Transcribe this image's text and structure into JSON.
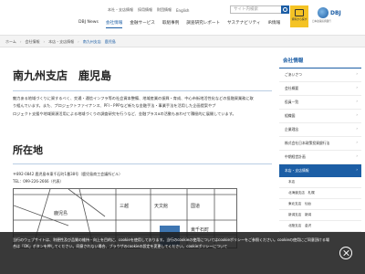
{
  "utility": {
    "items": [
      "本社・支店情報",
      "採用情報",
      "財団情報",
      "English"
    ],
    "search_placeholder": "サイト内検索"
  },
  "nav": {
    "items": [
      "DBJ News",
      "会社情報",
      "金融サービス",
      "取組事例",
      "調査研究レポート",
      "サステナビリティ",
      "IR情報"
    ]
  },
  "cta": {
    "label": "資料から探す"
  },
  "logo": {
    "name": "DBJ",
    "sub": "日本政策投資銀行"
  },
  "breadcrumb": {
    "items": [
      "ホーム",
      "会社情報",
      "本店・支店情報",
      "南九州支店　鹿児島"
    ]
  },
  "page": {
    "title": "南九州支店　鹿児島",
    "intro_lines": [
      "魅力ある地域づくりに資するべく、交通・通信インフラ等の社会資本整備、地域産業の振興・育成、中心市街地活性化などの投融資業務に取",
      "り組んでいます。また、プロジェクトファイナンス、PFI・PPPなど新たな金融手法・事業手法を活用した企画提案やプ",
      "ロジェクト支援や地域資源活用による地域づくりの調査研究を行うなど、金融プラスαの活動もあわせて積極的に展開しています。"
    ],
    "location_heading": "所在地",
    "address": "〒892-0842 鹿児島市東千石町1番38号（鹿児島商工会議所ビル）",
    "tel": "TEL：099-226-2666（代表）"
  },
  "map": {
    "labels": [
      "鹿児島",
      "三越",
      "天文館",
      "国道",
      "東千石町"
    ]
  },
  "sidebar": {
    "heading": "会社情報",
    "items": [
      {
        "label": "ごあいさつ"
      },
      {
        "label": "会社概要"
      },
      {
        "label": "役員一覧"
      },
      {
        "label": "組織図"
      },
      {
        "label": "企業理念"
      },
      {
        "label": "株式会社日本政策投資銀行法"
      },
      {
        "label": "中期経営計画"
      }
    ],
    "section": "本店・支店情報",
    "subitems": [
      {
        "label": "本店",
        "current": false
      },
      {
        "label": "北海道支店　札幌",
        "current": false
      },
      {
        "label": "東北支店　仙台",
        "current": false
      },
      {
        "label": "新潟支店　新潟",
        "current": false
      },
      {
        "label": "北陸支店　金沢",
        "current": false
      }
    ]
  },
  "cookie": {
    "text": "当行のウェブサイトは、利便性及び品質の維持・向上を目的に、cookieを使用しております。当行のcookieの使用についてはcookieポリシーをご参照ください。cookieの使用にご同意頂ける場合は「OK」ボタンを押してください。同意されない場合、ブラウザのcookieの設定を変更してください。cookieポリシーについて"
  },
  "colors": {
    "brand": "#1c5ea5",
    "accent": "#f4c325"
  }
}
